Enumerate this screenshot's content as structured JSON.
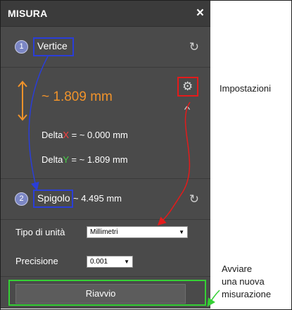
{
  "panel": {
    "title": "MISURA",
    "close_icon": "×"
  },
  "point1": {
    "number": "1",
    "label": "Vertice",
    "refresh_icon": "↻"
  },
  "measurement": {
    "value": "~ 1.809 mm",
    "delta_x_prefix": "Delta",
    "delta_x_axis": "X",
    "delta_x_value": " = ~ 0.000 mm",
    "delta_y_prefix": "Delta",
    "delta_y_axis": "Y",
    "delta_y_value": " = ~ 1.809 mm",
    "settings_icon": "⚙",
    "collapse_icon": "^"
  },
  "point2": {
    "number": "2",
    "label": "Spigolo",
    "value": "~ 4.495 mm",
    "refresh_icon": "↻"
  },
  "settings": {
    "unit_label": "Tipo di unità",
    "unit_value": "Millimetri",
    "precision_label": "Precisione",
    "precision_value": "0.001"
  },
  "actions": {
    "restart_label": "Riavvio"
  },
  "annotations": {
    "settings_note": "Impostazioni",
    "restart_note_line1": "Avviare",
    "restart_note_line2": "una nuova",
    "restart_note_line3": "misurazione"
  },
  "colors": {
    "panel_bg": "#4a4a4a",
    "accent_orange": "#f0932b",
    "highlight_blue": "#2a3ed8",
    "highlight_red": "#e31b1b",
    "highlight_green": "#35d035"
  }
}
